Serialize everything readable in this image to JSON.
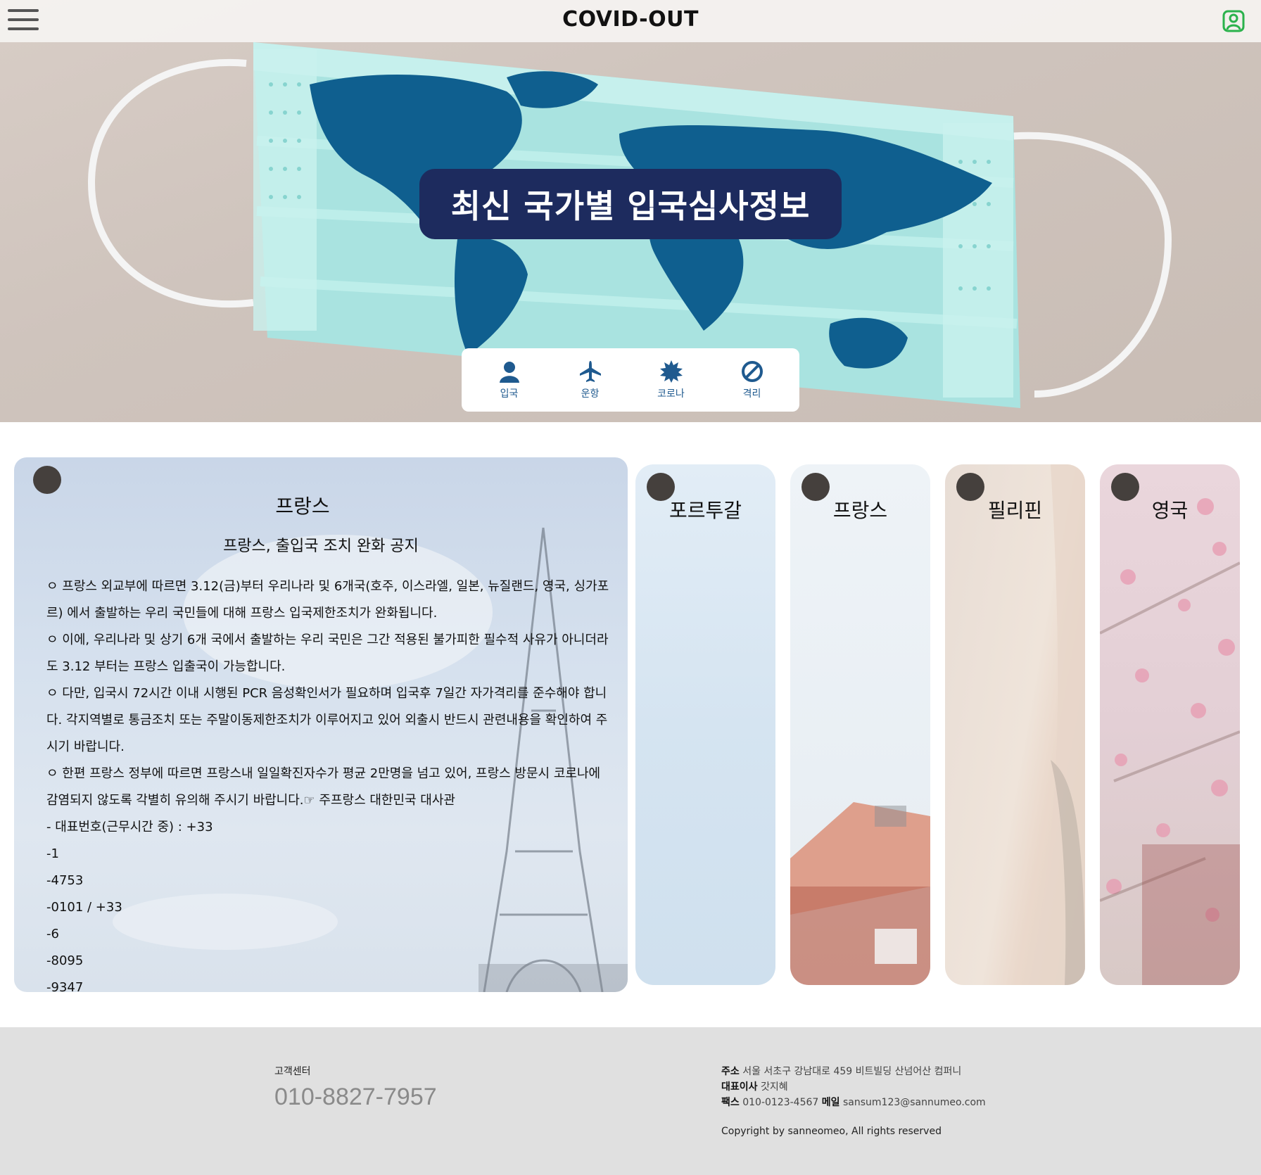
{
  "header": {
    "brand": "COVID-OUT",
    "menu_icon": "hamburger-menu-icon",
    "user_icon": "user-profile-icon",
    "user_icon_color": "#2bb24c"
  },
  "hero": {
    "title": "최신 국가별 입국심사정보",
    "title_bg": "#1d2b5e",
    "nav": [
      {
        "label": "입국",
        "icon": "person-icon"
      },
      {
        "label": "운항",
        "icon": "airplane-icon"
      },
      {
        "label": "코로나",
        "icon": "virus-icon"
      },
      {
        "label": "격리",
        "icon": "prohibited-icon"
      }
    ]
  },
  "main_card": {
    "country": "프랑스",
    "subtitle": "프랑스, 출입국 조치 완화 공지",
    "body": [
      "ㅇ 프랑스 외교부에 따르면 3.12(금)부터 우리나라 및 6개국(호주, 이스라엘, 일본, 뉴질랜드, 영국, 싱가포르) 에서 출발하는 우리 국민들에 대해 프랑스 입국제한조치가 완화됩니다.",
      " ㅇ 이에, 우리나라 및 상기 6개 국에서 출발하는 우리 국민은 그간 적용된 불가피한 필수적 사유가 아니더라도 3.12 부터는 프랑스 입출국이 가능합니다.",
      " ㅇ 다만, 입국시 72시간 이내 시행된 PCR 음성확인서가 필요하며 입국후 7일간 자가격리를 준수해야 합니다. 각지역별로 통금조치 또는 주말이동제한조치가 이루어지고 있어 외출시 반드시 관련내용을 확인하여 주시기 바랍니다.",
      " ㅇ 한편 프랑스 정부에 따르면 프랑스내 일일확진자수가 평균 2만명을 넘고 있어, 프랑스 방문시 코로나에 감염되지 않도록 각별히 유의해 주시기 바랍니다.☞ 주프랑스 대한민국 대사관",
      " - 대표번호(근무시간 중) : +33",
      " -1",
      " -4753",
      " -0101 / +33",
      " -6",
      " -8095",
      " -9347"
    ]
  },
  "side_cards": [
    {
      "title": "포르투갈"
    },
    {
      "title": "프랑스"
    },
    {
      "title": "필리핀"
    },
    {
      "title": "영국"
    }
  ],
  "footer": {
    "cs_label": "고객센터",
    "cs_phone": "010-8827-7957",
    "address_label": "주소",
    "address": "서울 서초구 강남대로 459 비트빌딩 산넘어산 컴퍼니",
    "ceo_label": "대표이사",
    "ceo": "갓지혜",
    "fax_label": "팩스",
    "fax": "010-0123-4567",
    "mail_label": "메일",
    "mail": "sansum123@sannumeo.com",
    "copyright": "Copyright by sanneomeo, All rights reserved"
  }
}
